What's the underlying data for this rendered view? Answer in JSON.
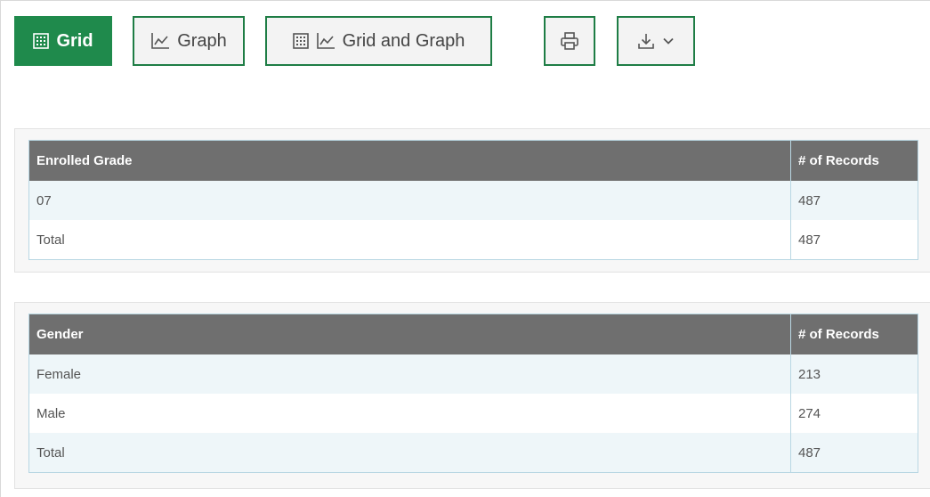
{
  "toolbar": {
    "grid_label": "Grid",
    "graph_label": "Graph",
    "grid_and_graph_label": "Grid and Graph",
    "accent_color": "#1f8a4c",
    "icons": {
      "grid": "grid-icon",
      "graph": "line-chart-icon",
      "print": "printer-icon",
      "download": "download-icon",
      "dropdown": "chevron-down-icon"
    }
  },
  "tables": {
    "grade": {
      "headers": [
        "Enrolled Grade",
        "# of Records"
      ],
      "rows": [
        [
          "07",
          "487"
        ],
        [
          "Total",
          "487"
        ]
      ]
    },
    "gender": {
      "headers": [
        "Gender",
        "# of Records"
      ],
      "rows": [
        [
          "Female",
          "213"
        ],
        [
          "Male",
          "274"
        ],
        [
          "Total",
          "487"
        ]
      ]
    }
  }
}
